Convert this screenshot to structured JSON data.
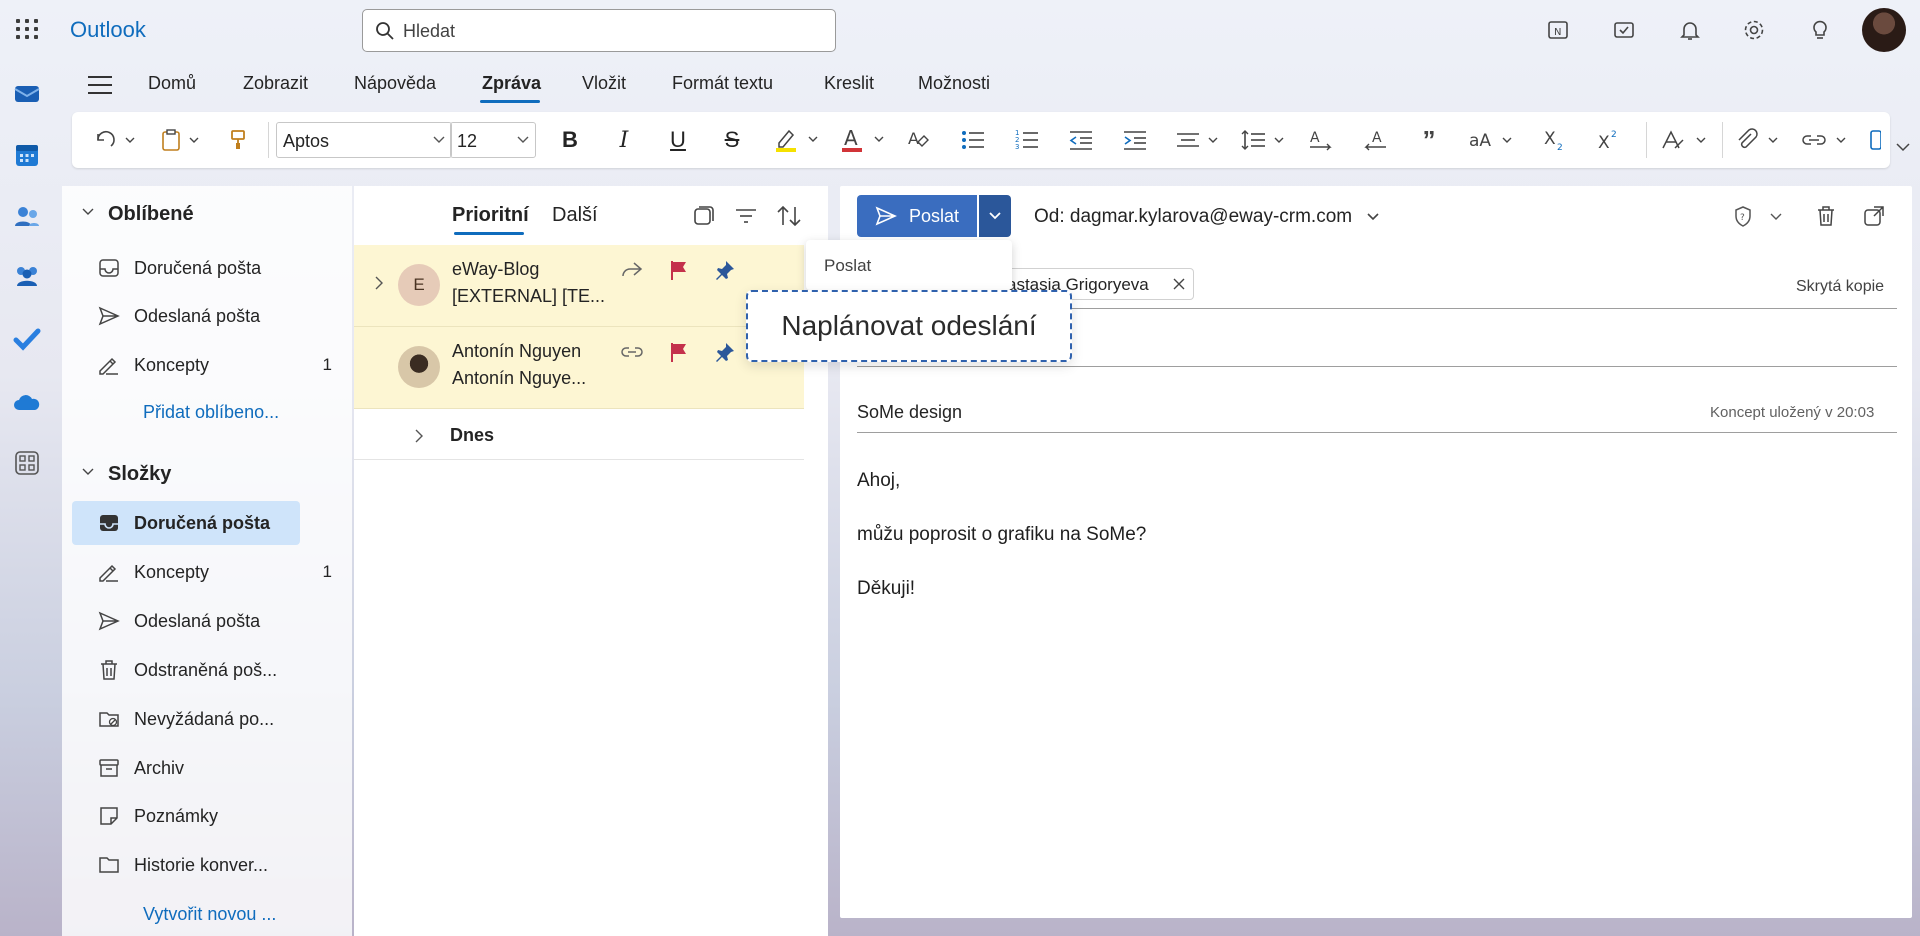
{
  "app": {
    "brand": "Outlook"
  },
  "search": {
    "placeholder": "Hledat"
  },
  "ribbon": {
    "tabs": [
      {
        "label": "Domů"
      },
      {
        "label": "Zobrazit"
      },
      {
        "label": "Nápověda"
      },
      {
        "label": "Zpráva",
        "active": true
      },
      {
        "label": "Vložit"
      },
      {
        "label": "Formát textu"
      },
      {
        "label": "Kreslit"
      },
      {
        "label": "Možnosti"
      }
    ],
    "font_name": "Aptos",
    "font_size": "12"
  },
  "folders": {
    "favorites_header": "Oblíbené",
    "favorites": [
      {
        "label": "Doručená pošta",
        "icon": "inbox-icon"
      },
      {
        "label": "Odeslaná pošta",
        "icon": "send-icon"
      },
      {
        "label": "Koncepty",
        "count": "1",
        "icon": "drafts-icon"
      }
    ],
    "add_favorite": "Přidat oblíbeno...",
    "folders_header": "Složky",
    "items": [
      {
        "label": "Doručená pošta",
        "icon": "inbox-icon",
        "active": true
      },
      {
        "label": "Koncepty",
        "count": "1",
        "icon": "drafts-icon"
      },
      {
        "label": "Odeslaná pošta",
        "icon": "send-icon"
      },
      {
        "label": "Odstraněná poš...",
        "icon": "trash-icon"
      },
      {
        "label": "Nevyžádaná po...",
        "icon": "junk-icon"
      },
      {
        "label": "Archiv",
        "icon": "archive-icon"
      },
      {
        "label": "Poznámky",
        "icon": "notes-icon"
      },
      {
        "label": "Historie konver...",
        "icon": "folder-icon"
      }
    ],
    "create_new": "Vytvořit novou ..."
  },
  "message_list": {
    "tab_focused": "Prioritní",
    "tab_other": "Další",
    "messages": [
      {
        "sender": "eWay-Blog",
        "subject": "[EXTERNAL] [TE...",
        "avatar_initial": "E"
      },
      {
        "sender": "Antonín Nguyen",
        "subject": "Antonín Nguye..."
      }
    ],
    "group_today": "Dnes"
  },
  "compose": {
    "send_label": "Poslat",
    "from_label": "Od: dagmar.kylarova@eway-crm.com",
    "dropdown_send": "Poslat",
    "tooltip": "Naplánovat odeslání",
    "recipient": "astasia Grigoryeva",
    "bcc_label": "Skrytá kopie",
    "subject": "SoMe design",
    "draft_saved": "Koncept uložený v 20:03",
    "body": [
      "Ahoj,",
      "můžu poprosit o grafiku na SoMe?",
      "Děkuji!"
    ]
  },
  "colors": {
    "accent": "#0f6cbd",
    "send_button": "#3a6dbf",
    "flag": "#c4314b",
    "pin": "#2b579a"
  }
}
